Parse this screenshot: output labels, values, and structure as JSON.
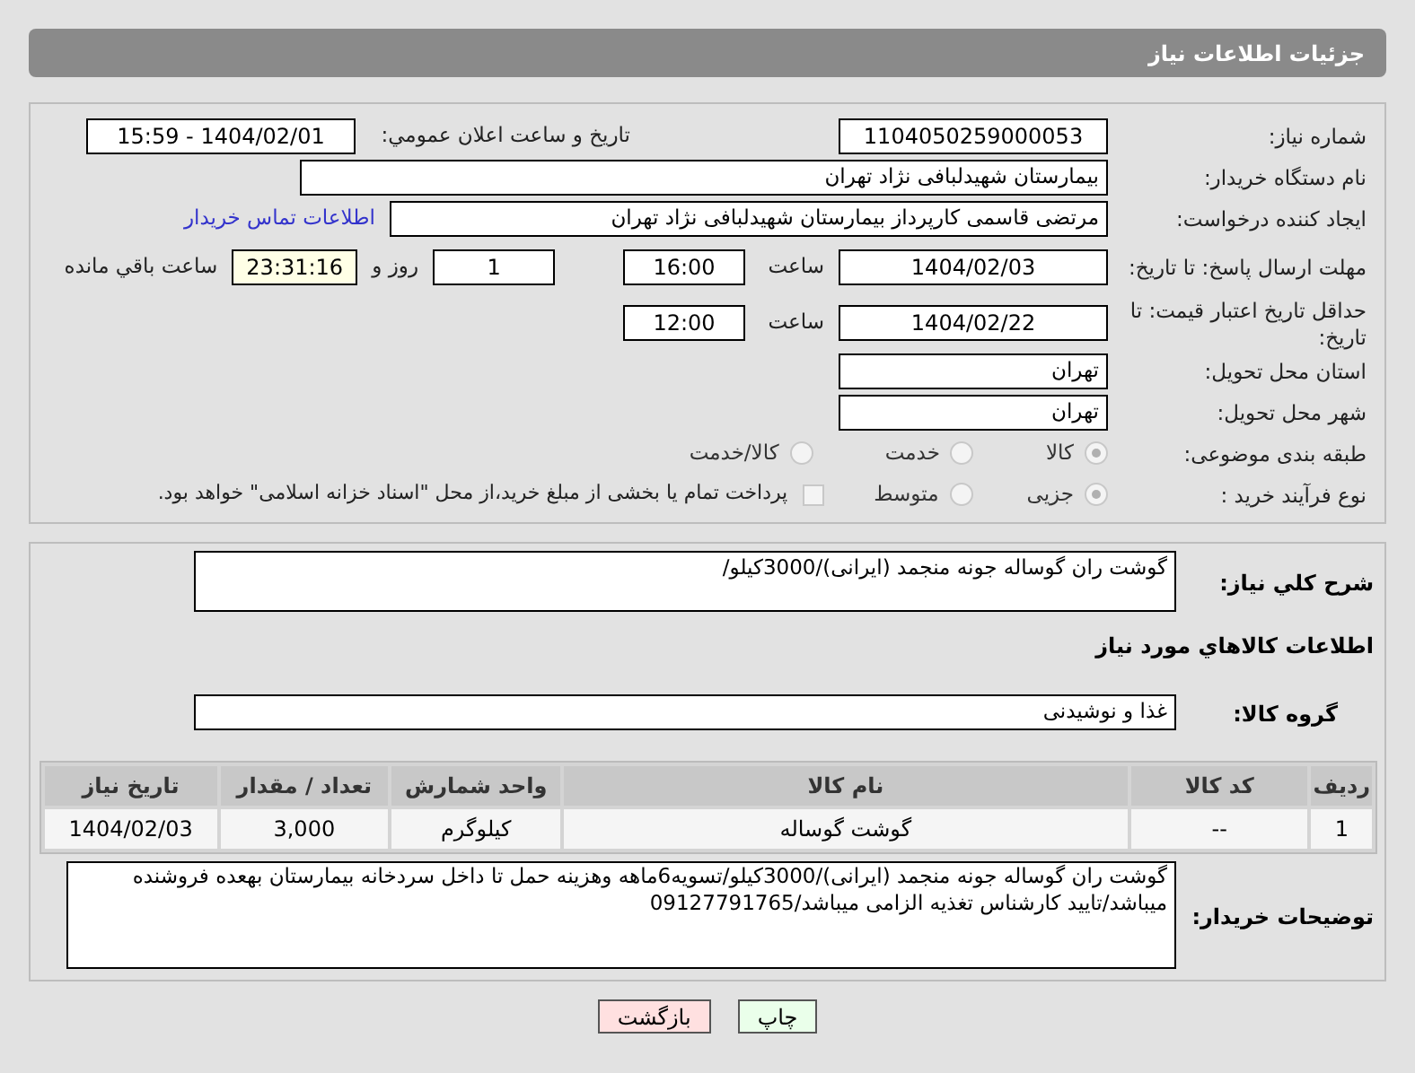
{
  "header": {
    "title": "جزئیات اطلاعات نیاز"
  },
  "need_number": {
    "label": "شماره نیاز:",
    "value": "1104050259000053"
  },
  "announce": {
    "label": "تاریخ و ساعت اعلان عمومي:",
    "value": "1404/02/01 - 15:59"
  },
  "buyer_org": {
    "label": "نام دستگاه خریدار:",
    "value": "بیمارستان شهیدلبافی نژاد تهران"
  },
  "creator": {
    "label": "ایجاد کننده درخواست:",
    "value": "مرتضی  قاسمی کارپرداز بیمارستان شهیدلبافی نژاد تهران",
    "link": "اطلاعات تماس خریدار"
  },
  "deadline": {
    "label": "مهلت ارسال پاسخ: تا تاریخ:",
    "date": "1404/02/03",
    "time_label": "ساعت",
    "time": "16:00",
    "days": "1",
    "days_label": "روز و",
    "remaining": "23:31:16",
    "remaining_label": "ساعت باقي مانده"
  },
  "validity": {
    "label": "حداقل تاریخ اعتبار قیمت: تا تاریخ:",
    "date": "1404/02/22",
    "time_label": "ساعت",
    "time": "12:00"
  },
  "province": {
    "label": "استان محل تحویل:",
    "value": "تهران"
  },
  "city": {
    "label": "شهر محل تحویل:",
    "value": "تهران"
  },
  "category": {
    "label": "طبقه بندی موضوعی:",
    "options": [
      {
        "label": "کالا",
        "selected": true
      },
      {
        "label": "خدمت",
        "selected": false
      },
      {
        "label": "کالا/خدمت",
        "selected": false
      }
    ]
  },
  "process": {
    "label": "نوع فرآیند خرید :",
    "options": [
      {
        "label": "جزیی",
        "selected": true
      },
      {
        "label": "متوسط",
        "selected": false
      }
    ],
    "treasury": {
      "label": "پرداخت تمام یا بخشی از مبلغ خرید،از محل \"اسناد خزانه اسلامی\" خواهد بود.",
      "checked": false
    }
  },
  "summary": {
    "label": "شرح کلي نیاز:",
    "value": "گوشت ران گوساله جونه منجمد (ایرانی)/3000کیلو/"
  },
  "items_heading": "اطلاعات کالاهاي مورد نیاز",
  "goods_group": {
    "label": "گروه کالا:",
    "value": "غذا و نوشیدنی"
  },
  "table": {
    "columns": [
      "ردیف",
      "کد کالا",
      "نام کالا",
      "واحد شمارش",
      "تعداد / مقدار",
      "تاریخ نیاز"
    ],
    "rows": [
      [
        "1",
        "--",
        "گوشت گوساله",
        "کیلوگرم",
        "3,000",
        "1404/02/03"
      ]
    ]
  },
  "buyer_notes": {
    "label": "توضیحات خریدار:",
    "value": "گوشت ران گوساله جونه منجمد (ایرانی)/3000کیلو/تسویه6ماهه وهزینه حمل تا داخل سردخانه بیمارستان بهعده فروشنده میباشد/تایید کارشناس تغذیه الزامی میباشد/09127791765"
  },
  "buttons": [
    {
      "label": "چاپ",
      "kind": "print"
    },
    {
      "label": "بازگشت",
      "kind": "back"
    }
  ]
}
